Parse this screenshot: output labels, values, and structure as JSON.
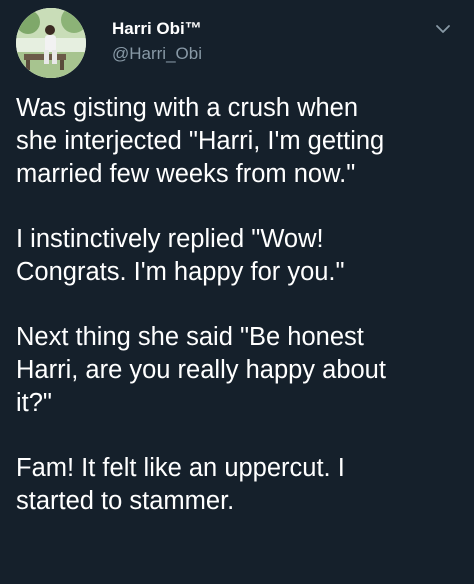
{
  "author": {
    "display_name": "Harri Obi™",
    "handle": "@Harri_Obi"
  },
  "icons": {
    "avatar": "profile-photo",
    "menu": "chevron-down-icon"
  },
  "tweet": {
    "paragraphs": [
      "Was gisting with a crush when\nshe interjected \"Harri, I'm getting\nmarried few weeks from now.\"",
      "I instinctively replied \"Wow!\nCongrats. I'm happy for you.\"",
      "Next thing she said \"Be honest\nHarri, are you really happy about\nit?\"",
      "Fam! It felt like an uppercut. I\nstarted to stammer."
    ]
  },
  "colors": {
    "background": "#15202b",
    "text": "#ffffff",
    "secondary_text": "#8899a6"
  }
}
